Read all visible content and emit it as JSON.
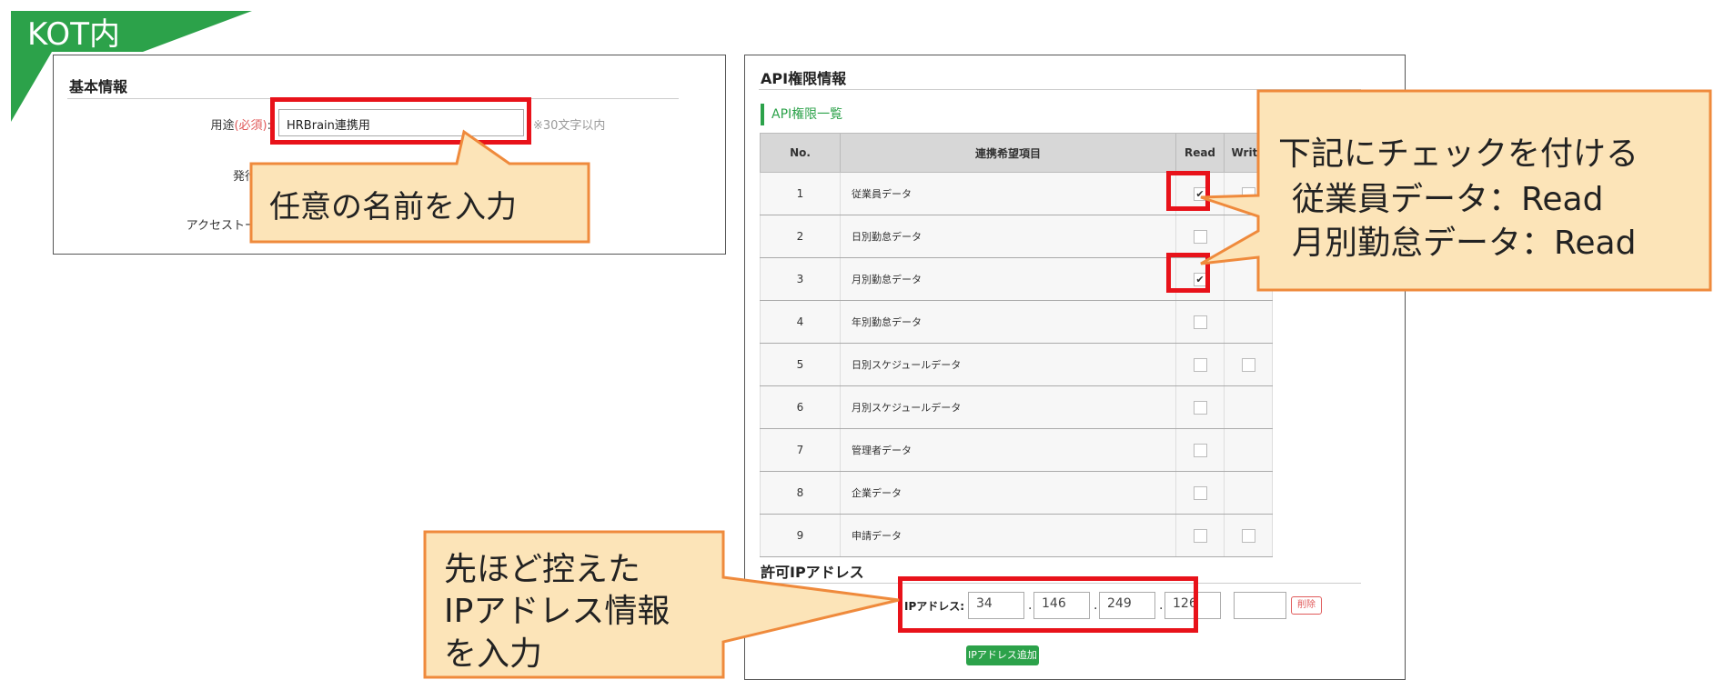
{
  "tag": {
    "label": "KOT内"
  },
  "basic_info": {
    "title": "基本情報",
    "purpose_label": "用途",
    "required_mark": "(必須)",
    "purpose_value": "HRBrain連携用",
    "purpose_hint": "※30文字以内",
    "issuer_label_partial": "発行",
    "access_label_partial": "アクセストー"
  },
  "api_perm": {
    "title": "API権限情報",
    "list_tab": "API権限一覧",
    "columns": {
      "no": "No.",
      "item": "連携希望項目",
      "read": "Read",
      "write": "Write"
    },
    "rows": [
      {
        "no": "1",
        "name": "従業員データ",
        "read_checked": true,
        "write": true
      },
      {
        "no": "2",
        "name": "日別勤怠データ",
        "read_checked": false,
        "write": false
      },
      {
        "no": "3",
        "name": "月別勤怠データ",
        "read_checked": true,
        "write": false
      },
      {
        "no": "4",
        "name": "年別勤怠データ",
        "read_checked": false,
        "write": false
      },
      {
        "no": "5",
        "name": "日別スケジュールデータ",
        "read_checked": false,
        "write": true
      },
      {
        "no": "6",
        "name": "月別スケジュールデータ",
        "read_checked": false,
        "write": false
      },
      {
        "no": "7",
        "name": "管理者データ",
        "read_checked": false,
        "write": false
      },
      {
        "no": "8",
        "name": "企業データ",
        "read_checked": false,
        "write": false
      },
      {
        "no": "9",
        "name": "申請データ",
        "read_checked": false,
        "write": true
      }
    ]
  },
  "ip": {
    "title": "許可IPアドレス",
    "label": "IPアドレス:",
    "octets": [
      "34",
      "146",
      "249",
      "126"
    ],
    "extra_value": "",
    "delete_label": "削除",
    "add_label": "IPアドレス追加"
  },
  "callouts": {
    "name": "任意の名前を入力",
    "check_line1": "下記にチェックを付ける",
    "check_line2": "従業員データ：Read",
    "check_line3": "月別勤怠データ：Read",
    "ip_line1": "先ほど控えた",
    "ip_line2": "IPアドレス情報",
    "ip_line3": "を入力"
  },
  "colors": {
    "accent_green": "#2ca24a",
    "highlight_red": "#e8121a",
    "callout_fill": "#fce4b8",
    "callout_border": "#ef8a3c"
  }
}
